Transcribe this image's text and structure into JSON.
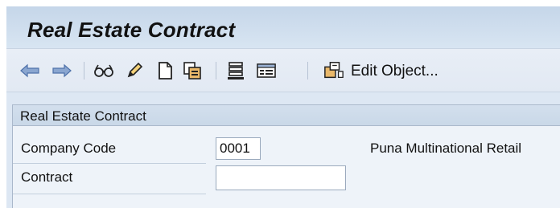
{
  "window": {
    "title": "Real Estate Contract"
  },
  "toolbar": {
    "buttons": [
      {
        "name": "back-arrow-icon"
      },
      {
        "name": "forward-arrow-icon"
      },
      {
        "name": "glasses-display-icon"
      },
      {
        "name": "pencil-change-icon"
      },
      {
        "name": "new-document-icon"
      },
      {
        "name": "copy-icon"
      },
      {
        "name": "list-icon"
      },
      {
        "name": "overview-icon"
      },
      {
        "name": "edit-object-icon"
      }
    ],
    "edit_object_label": "Edit Object..."
  },
  "group": {
    "title": "Real Estate Contract",
    "company_code_label": "Company Code",
    "company_code_value": "0001",
    "company_name": "Puna Multinational Retail",
    "contract_label": "Contract",
    "contract_value": ""
  },
  "colors": {
    "title_bar": "#c5d6e9",
    "toolbar": "#e5ecf5",
    "panel": "#eef3f9",
    "arrow_blue": "#5a7fb8"
  }
}
